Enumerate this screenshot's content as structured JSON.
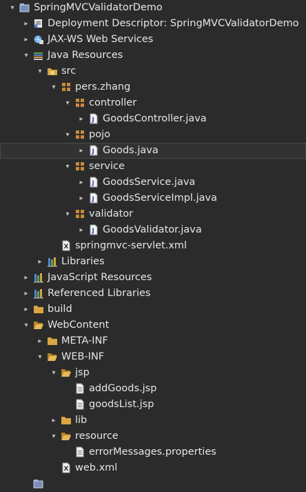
{
  "explorer": {
    "rows": [
      {
        "label": "SpringMVCValidatorDemo",
        "arrow": "▾",
        "icon": "project-icon"
      },
      {
        "label": "Deployment Descriptor: SpringMVCValidatorDemo",
        "arrow": "▸",
        "icon": "descriptor-icon"
      },
      {
        "label": "JAX-WS Web Services",
        "arrow": "▸",
        "icon": "webservice-icon"
      },
      {
        "label": "Java Resources",
        "arrow": "▾",
        "icon": "java-resources-icon"
      },
      {
        "label": "src",
        "arrow": "▾",
        "icon": "source-folder-icon"
      },
      {
        "label": "pers.zhang",
        "arrow": "▾",
        "icon": "package-icon"
      },
      {
        "label": "controller",
        "arrow": "▾",
        "icon": "package-icon"
      },
      {
        "label": "GoodsController.java",
        "arrow": "▸",
        "icon": "java-file-icon"
      },
      {
        "label": "pojo",
        "arrow": "▾",
        "icon": "package-icon"
      },
      {
        "label": "Goods.java",
        "arrow": "▸",
        "icon": "java-file-icon"
      },
      {
        "label": "service",
        "arrow": "▾",
        "icon": "package-icon"
      },
      {
        "label": "GoodsService.java",
        "arrow": "▸",
        "icon": "java-interface-icon"
      },
      {
        "label": "GoodsServiceImpl.java",
        "arrow": "▸",
        "icon": "java-file-icon"
      },
      {
        "label": "validator",
        "arrow": "▾",
        "icon": "package-icon"
      },
      {
        "label": "GoodsValidator.java",
        "arrow": "▸",
        "icon": "java-file-icon"
      },
      {
        "label": "springmvc-servlet.xml",
        "arrow": "",
        "icon": "xml-file-icon"
      },
      {
        "label": "Libraries",
        "arrow": "▸",
        "icon": "libraries-icon"
      },
      {
        "label": "JavaScript Resources",
        "arrow": "▸",
        "icon": "libraries-icon"
      },
      {
        "label": "Referenced Libraries",
        "arrow": "▸",
        "icon": "libraries-icon"
      },
      {
        "label": "build",
        "arrow": "▸",
        "icon": "folder-icon"
      },
      {
        "label": "WebContent",
        "arrow": "▾",
        "icon": "folder-open-icon"
      },
      {
        "label": "META-INF",
        "arrow": "▸",
        "icon": "folder-icon"
      },
      {
        "label": "WEB-INF",
        "arrow": "▾",
        "icon": "folder-open-icon"
      },
      {
        "label": "jsp",
        "arrow": "▾",
        "icon": "folder-open-icon"
      },
      {
        "label": "addGoods.jsp",
        "arrow": "",
        "icon": "text-file-icon"
      },
      {
        "label": "goodsList.jsp",
        "arrow": "",
        "icon": "text-file-icon"
      },
      {
        "label": "lib",
        "arrow": "▸",
        "icon": "folder-icon"
      },
      {
        "label": "resource",
        "arrow": "▾",
        "icon": "folder-open-icon"
      },
      {
        "label": "errorMessages.properties",
        "arrow": "",
        "icon": "text-file-icon"
      },
      {
        "label": "web.xml",
        "arrow": "",
        "icon": "xml-file-icon"
      },
      {
        "label": "",
        "arrow": "",
        "icon": "project-icon"
      }
    ],
    "selected_label": "Goods.java"
  },
  "colors": {
    "background": "#2b2b2b",
    "text": "#e6e6e6",
    "folder": "#d9a441",
    "package": "#c98a3c",
    "java": "#5a7fd6"
  }
}
